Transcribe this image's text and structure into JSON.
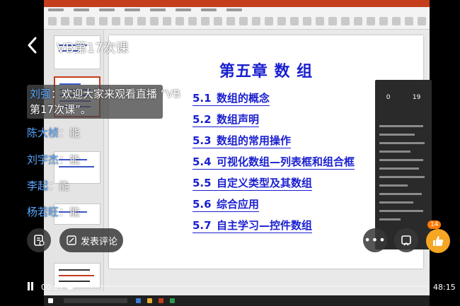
{
  "video": {
    "title": "VB第17次课",
    "current_time": "00:07",
    "total_time": "48:15",
    "progress": 0.01,
    "comment_label": "发表评论",
    "like_count": "14"
  },
  "chat": [
    {
      "user": "刘强",
      "text": "：欢迎大家来观看直播 “VB",
      "text2": "第17次课”。"
    },
    {
      "user": "陈大桢",
      "text": "：能"
    },
    {
      "user": "刘宇杰",
      "text": "：能"
    },
    {
      "user": "李起",
      "text": "：能"
    },
    {
      "user": "杨若旺",
      "text": "：能"
    }
  ],
  "slide": {
    "title": "第五章 数 组",
    "items": [
      {
        "num": "5.1",
        "label": "数组的概念"
      },
      {
        "num": "5.2",
        "label": "数组声明"
      },
      {
        "num": "5.3",
        "label": "数组的常用操作"
      },
      {
        "num": "5.4",
        "label": "可视化数组—列表框和组合框"
      },
      {
        "num": "5.5",
        "label": "自定义类型及其数组"
      },
      {
        "num": "5.6",
        "label": "综合应用"
      },
      {
        "num": "5.7",
        "label": "自主学习—控件数组"
      }
    ]
  },
  "side_panel": {
    "stat1": "0",
    "stat2": "19"
  },
  "colors": {
    "slide_text": "#1a1fcf",
    "ppt_accent": "#c43e1c",
    "chat_user": "#5aa7ff",
    "like": "#f5a623"
  }
}
